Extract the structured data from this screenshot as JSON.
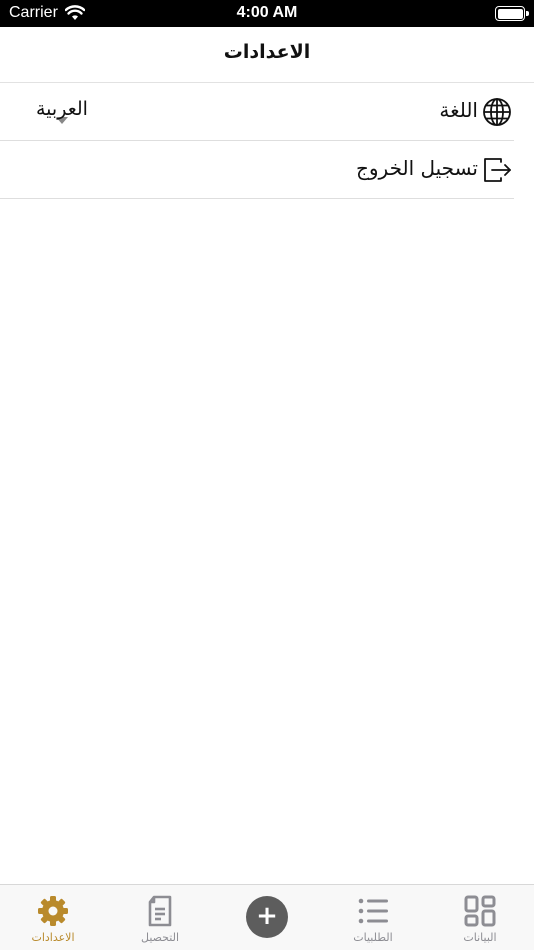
{
  "status_bar": {
    "carrier": "Carrier",
    "time": "4:00 AM"
  },
  "header": {
    "title": "الاعدادات"
  },
  "settings": {
    "language": {
      "label": "اللغة",
      "value": "العربية",
      "icon": "globe-icon"
    },
    "logout": {
      "label": "تسجيل الخروج",
      "icon": "logout-icon"
    }
  },
  "tab_bar": {
    "tabs": [
      {
        "id": "data",
        "label": "البيانات",
        "icon": "grid-icon",
        "active": false
      },
      {
        "id": "orders",
        "label": "الطلبيات",
        "icon": "list-icon",
        "active": false
      },
      {
        "id": "add",
        "label": "+",
        "icon": "plus-icon",
        "active": false
      },
      {
        "id": "collection",
        "label": "التحصيل",
        "icon": "document-icon",
        "active": false
      },
      {
        "id": "settings",
        "label": "الاعدادات",
        "icon": "gear-icon",
        "active": true
      }
    ]
  },
  "colors": {
    "active_tab": "#b98a2c",
    "inactive_tab": "#8d8d93",
    "add_button": "#5d5d5d"
  }
}
